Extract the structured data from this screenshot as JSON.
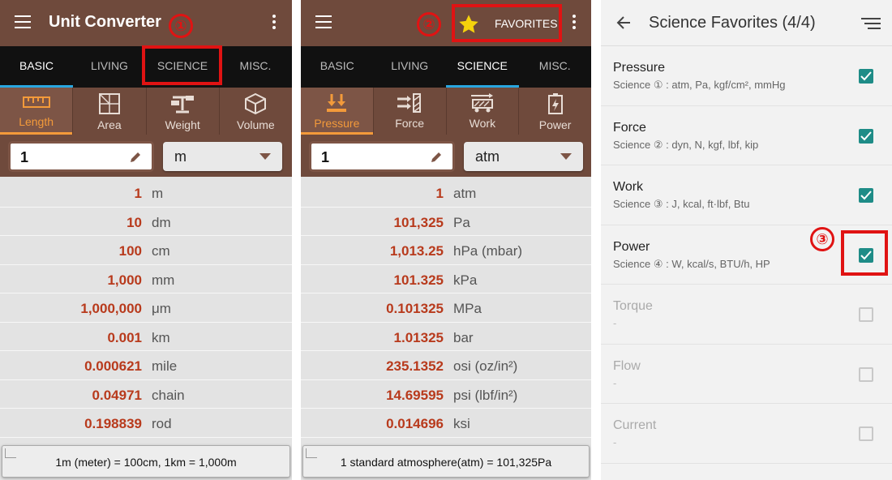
{
  "screen1": {
    "title": "Unit Converter",
    "tabs": [
      "BASIC",
      "LIVING",
      "SCIENCE",
      "MISC."
    ],
    "active_tab": "BASIC",
    "categories": [
      {
        "label": "Length",
        "icon": "ruler-icon"
      },
      {
        "label": "Area",
        "icon": "grid-area-icon"
      },
      {
        "label": "Weight",
        "icon": "scale-icon"
      },
      {
        "label": "Volume",
        "icon": "cube-icon"
      }
    ],
    "input_value": "1",
    "unit": "m",
    "results": [
      {
        "value": "1",
        "unit": "m"
      },
      {
        "value": "10",
        "unit": "dm"
      },
      {
        "value": "100",
        "unit": "cm"
      },
      {
        "value": "1,000",
        "unit": "mm"
      },
      {
        "value": "1,000,000",
        "unit": "μm"
      },
      {
        "value": "0.001",
        "unit": "km"
      },
      {
        "value": "0.000621",
        "unit": "mile"
      },
      {
        "value": "0.04971",
        "unit": "chain"
      },
      {
        "value": "0.198839",
        "unit": "rod"
      }
    ],
    "footer": "1m (meter) = 100cm, 1km = 1,000m",
    "marker": "①"
  },
  "screen2": {
    "favorites_label": "FAVORITES",
    "tabs": [
      "BASIC",
      "LIVING",
      "SCIENCE",
      "MISC."
    ],
    "active_tab": "SCIENCE",
    "categories": [
      {
        "label": "Pressure",
        "icon": "pressure-icon"
      },
      {
        "label": "Force",
        "icon": "force-icon"
      },
      {
        "label": "Work",
        "icon": "work-icon"
      },
      {
        "label": "Power",
        "icon": "battery-icon"
      }
    ],
    "input_value": "1",
    "unit": "atm",
    "results": [
      {
        "value": "1",
        "unit": "atm"
      },
      {
        "value": "101,325",
        "unit": "Pa"
      },
      {
        "value": "1,013.25",
        "unit": "hPa (mbar)"
      },
      {
        "value": "101.325",
        "unit": "kPa"
      },
      {
        "value": "0.101325",
        "unit": "MPa"
      },
      {
        "value": "1.01325",
        "unit": "bar"
      },
      {
        "value": "235.1352",
        "unit": "osi (oz/in²)"
      },
      {
        "value": "14.69595",
        "unit": "psi (lbf/in²)"
      },
      {
        "value": "0.014696",
        "unit": "ksi"
      }
    ],
    "footer": "1 standard atmosphere(atm) = 101,325Pa",
    "marker": "②"
  },
  "screen3": {
    "title": "Science Favorites (4/4)",
    "items": [
      {
        "name": "Pressure",
        "sub": "Science ① : atm, Pa, kgf/cm², mmHg",
        "checked": true
      },
      {
        "name": "Force",
        "sub": "Science ② : dyn, N, kgf, lbf, kip",
        "checked": true
      },
      {
        "name": "Work",
        "sub": "Science ③ : J, kcal, ft·lbf, Btu",
        "checked": true
      },
      {
        "name": "Power",
        "sub": "Science ④ : W, kcal/s, BTU/h, HP",
        "checked": true
      },
      {
        "name": "Torque",
        "sub": "-",
        "checked": false
      },
      {
        "name": "Flow",
        "sub": "-",
        "checked": false
      },
      {
        "name": "Current",
        "sub": "-",
        "checked": false
      }
    ],
    "marker": "③"
  },
  "colors": {
    "brand_brown": "#6f4a3c",
    "accent_orange": "#f39a3a",
    "result_red": "#b83a1c",
    "check_teal": "#1e8c87",
    "highlight_red": "#e01313",
    "tab_indicator": "#29a6df"
  }
}
